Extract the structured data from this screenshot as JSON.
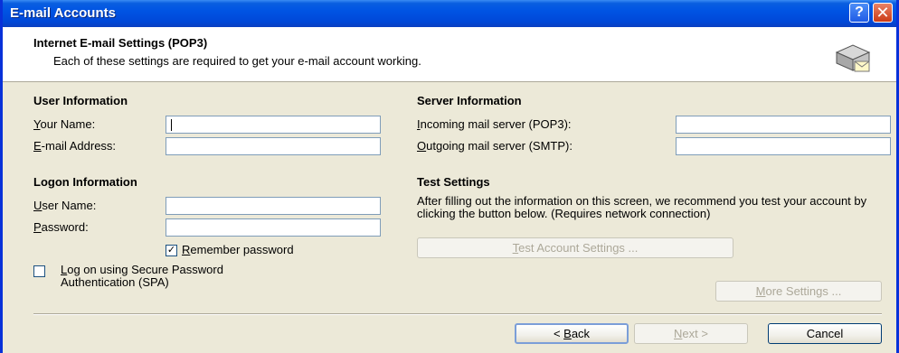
{
  "window": {
    "title": "E-mail Accounts",
    "help_glyph": "?",
    "close_glyph": "✕"
  },
  "header": {
    "title": "Internet E-mail Settings (POP3)",
    "subtitle": "Each of these settings are required to get your e-mail account working."
  },
  "user_info": {
    "heading": "User Information",
    "name_label_u": "Y",
    "name_label_rest": "our Name:",
    "name_value": "",
    "email_label_u": "E",
    "email_label_rest": "-mail Address:",
    "email_value": ""
  },
  "server_info": {
    "heading": "Server Information",
    "incoming_label_u": "I",
    "incoming_label_rest": "ncoming mail server (POP3):",
    "incoming_value": "",
    "outgoing_label_u": "O",
    "outgoing_label_rest": "utgoing mail server (SMTP):",
    "outgoing_value": ""
  },
  "logon_info": {
    "heading": "Logon Information",
    "user_label_u": "U",
    "user_label_rest": "ser Name:",
    "user_value": "",
    "password_label_u": "P",
    "password_label_rest": "assword:",
    "password_value": "",
    "remember_label_u": "R",
    "remember_label_rest": "emember password",
    "remember_checked": true,
    "remember_check_glyph": "✓",
    "spa_label_line1_pre": "",
    "spa_label_u": "L",
    "spa_label_line1_rest": "og on using Secure Password",
    "spa_label_line2": "Authentication (SPA)",
    "spa_checked": false
  },
  "test_settings": {
    "heading": "Test Settings",
    "description": "After filling out the information on this screen, we recommend you test your account by clicking the button below. (Requires network connection)",
    "button_u": "T",
    "button_rest": "est Account Settings ..."
  },
  "more_settings": {
    "button_u": "M",
    "button_rest": "ore Settings ..."
  },
  "footer": {
    "back_pre": "< ",
    "back_u": "B",
    "back_rest": "ack",
    "next_u": "N",
    "next_rest": "ext >",
    "cancel": "Cancel"
  },
  "colors": {
    "titlebar": "#0054e3",
    "dialog_bg": "#ece9d8",
    "field_border": "#7f9db9"
  }
}
